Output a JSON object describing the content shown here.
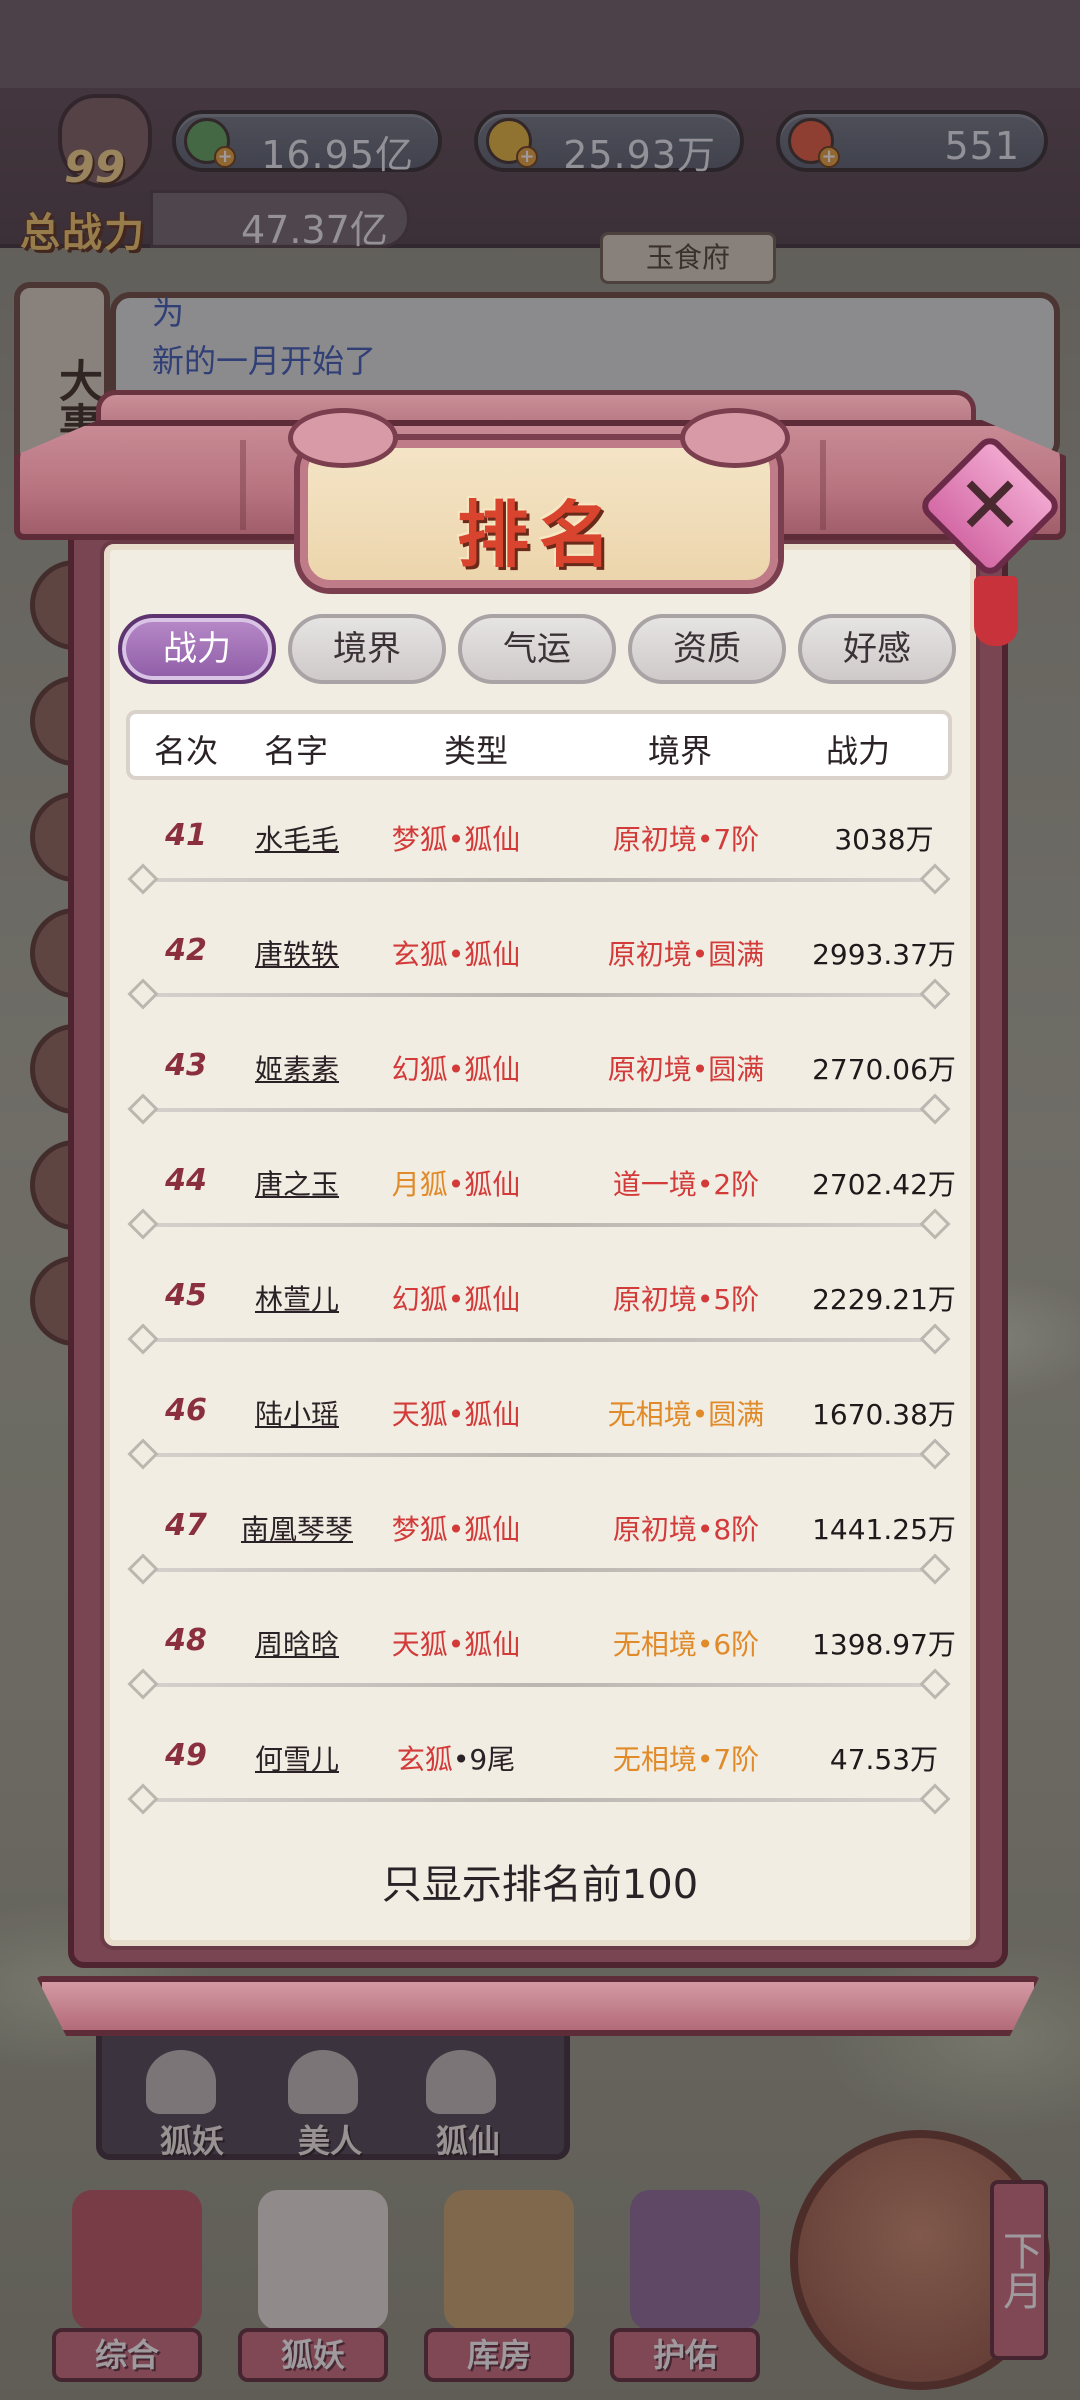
{
  "hud": {
    "power_level": "99",
    "total_power_label": "总战力",
    "total_power_value": "47.37亿",
    "resources": [
      {
        "icon": "green-leaf-icon",
        "value": "16.95亿"
      },
      {
        "icon": "gold-ingot-icon",
        "value": "25.93万"
      },
      {
        "icon": "peach-icon",
        "value": "551"
      }
    ],
    "location": "玉食府"
  },
  "events": {
    "side_tab": "大事记",
    "cut_line": "为",
    "line1": "新的一月开始了"
  },
  "modal": {
    "title": "排名",
    "tabs": [
      {
        "label": "战力",
        "active": true
      },
      {
        "label": "境界",
        "active": false
      },
      {
        "label": "气运",
        "active": false
      },
      {
        "label": "资质",
        "active": false
      },
      {
        "label": "好感",
        "active": false
      }
    ],
    "columns": {
      "rank": "名次",
      "name": "名字",
      "type": "类型",
      "realm": "境界",
      "power": "战力"
    },
    "rows": [
      {
        "rank": "41",
        "name": "水毛毛",
        "type_a": "梦狐",
        "type_b": "•狐仙",
        "realm": "原初境•7阶",
        "power": "3038万",
        "type_color": "red",
        "realm_color": "red"
      },
      {
        "rank": "42",
        "name": "唐轶轶",
        "type_a": "玄狐",
        "type_b": "•狐仙",
        "realm": "原初境•圆满",
        "power": "2993.37万",
        "type_color": "red",
        "realm_color": "red"
      },
      {
        "rank": "43",
        "name": "姬素素",
        "type_a": "幻狐",
        "type_b": "•狐仙",
        "realm": "原初境•圆满",
        "power": "2770.06万",
        "type_color": "red",
        "realm_color": "red"
      },
      {
        "rank": "44",
        "name": "唐之玉",
        "type_a": "月狐",
        "type_b": "•狐仙",
        "realm": "道一境•2阶",
        "power": "2702.42万",
        "type_color": "orange",
        "realm_color": "red"
      },
      {
        "rank": "45",
        "name": "林萱儿",
        "type_a": "幻狐",
        "type_b": "•狐仙",
        "realm": "原初境•5阶",
        "power": "2229.21万",
        "type_color": "red",
        "realm_color": "red"
      },
      {
        "rank": "46",
        "name": "陆小瑶",
        "type_a": "天狐",
        "type_b": "•狐仙",
        "realm": "无相境•圆满",
        "power": "1670.38万",
        "type_color": "red",
        "realm_color": "orange"
      },
      {
        "rank": "47",
        "name": "南凰琴琴",
        "type_a": "梦狐",
        "type_b": "•狐仙",
        "realm": "原初境•8阶",
        "power": "1441.25万",
        "type_color": "red",
        "realm_color": "red"
      },
      {
        "rank": "48",
        "name": "周晗晗",
        "type_a": "天狐",
        "type_b": "•狐仙",
        "realm": "无相境•6阶",
        "power": "1398.97万",
        "type_color": "red",
        "realm_color": "orange"
      },
      {
        "rank": "49",
        "name": "何雪儿",
        "type_a": "玄狐",
        "type_b": "•9尾",
        "realm": "无相境•7阶",
        "power": "47.53万",
        "type_color": "red",
        "realm_color": "orange"
      }
    ],
    "footer": "只显示排名前100"
  },
  "bottom": {
    "units": [
      "狐妖",
      "美人",
      "狐仙"
    ],
    "nav": [
      "综合",
      "狐妖",
      "库房",
      "护佑"
    ],
    "month": "下月"
  },
  "colors": {
    "red": "#d33a3a",
    "orange": "#e08a2a",
    "active_tab": "#8e5ca6",
    "title": "#d9442f"
  }
}
